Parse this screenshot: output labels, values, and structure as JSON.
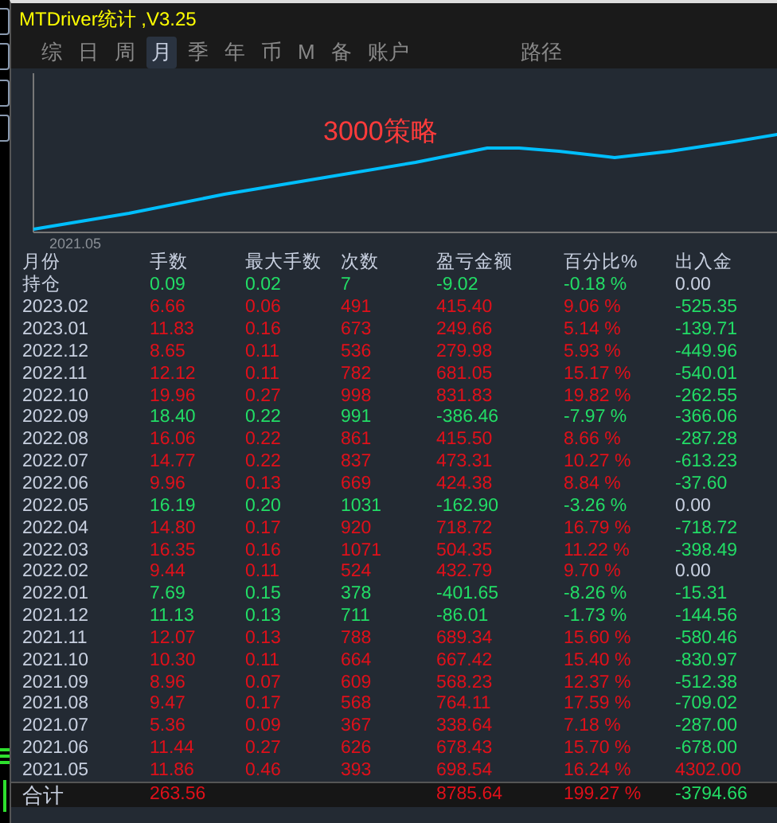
{
  "window": {
    "title": "MTDriver统计 ,V3.25"
  },
  "tabs": [
    {
      "label": "综",
      "selected": false
    },
    {
      "label": "日",
      "selected": false
    },
    {
      "label": "周",
      "selected": false
    },
    {
      "label": "月",
      "selected": true
    },
    {
      "label": "季",
      "selected": false
    },
    {
      "label": "年",
      "selected": false
    },
    {
      "label": "币",
      "selected": false
    },
    {
      "label": "M",
      "selected": false
    },
    {
      "label": "备",
      "selected": false
    },
    {
      "label": "账户",
      "selected": false
    },
    {
      "label": "路径",
      "selected": false
    }
  ],
  "chart": {
    "title": "3000策略",
    "x_label": "2021.05"
  },
  "table": {
    "columns": [
      "月份",
      "手数",
      "最大手数",
      "次数",
      "盈亏金额",
      "百分比%",
      "出入金"
    ],
    "position": {
      "month": "持仓",
      "lots": "0.09",
      "max_lots": "0.02",
      "count": "7",
      "profit": "-9.02",
      "pct": "-0.18 %",
      "color": "#22dd66",
      "flow": {
        "text": "0.00",
        "color": "#c8d0e0"
      }
    },
    "rows": [
      {
        "month": "2023.02",
        "lots": "6.66",
        "max_lots": "0.06",
        "count": "491",
        "profit": "415.40",
        "pct": "9.06 %",
        "color": "#e0101a",
        "flow": {
          "text": "-525.35",
          "color": "#22dd66"
        }
      },
      {
        "month": "2023.01",
        "lots": "11.83",
        "max_lots": "0.16",
        "count": "673",
        "profit": "249.66",
        "pct": "5.14 %",
        "color": "#e0101a",
        "flow": {
          "text": "-139.71",
          "color": "#22dd66"
        }
      },
      {
        "month": "2022.12",
        "lots": "8.65",
        "max_lots": "0.11",
        "count": "536",
        "profit": "279.98",
        "pct": "5.93 %",
        "color": "#e0101a",
        "flow": {
          "text": "-449.96",
          "color": "#22dd66"
        }
      },
      {
        "month": "2022.11",
        "lots": "12.12",
        "max_lots": "0.11",
        "count": "782",
        "profit": "681.05",
        "pct": "15.17 %",
        "color": "#e0101a",
        "flow": {
          "text": "-540.01",
          "color": "#22dd66"
        }
      },
      {
        "month": "2022.10",
        "lots": "19.96",
        "max_lots": "0.27",
        "count": "998",
        "profit": "831.83",
        "pct": "19.82 %",
        "color": "#e0101a",
        "flow": {
          "text": "-262.55",
          "color": "#22dd66"
        }
      },
      {
        "month": "2022.09",
        "lots": "18.40",
        "max_lots": "0.22",
        "count": "991",
        "profit": "-386.46",
        "pct": "-7.97 %",
        "color": "#22dd66",
        "flow": {
          "text": "-366.06",
          "color": "#22dd66"
        }
      },
      {
        "month": "2022.08",
        "lots": "16.06",
        "max_lots": "0.22",
        "count": "861",
        "profit": "415.50",
        "pct": "8.66 %",
        "color": "#e0101a",
        "flow": {
          "text": "-287.28",
          "color": "#22dd66"
        }
      },
      {
        "month": "2022.07",
        "lots": "14.77",
        "max_lots": "0.22",
        "count": "837",
        "profit": "473.31",
        "pct": "10.27 %",
        "color": "#e0101a",
        "flow": {
          "text": "-613.23",
          "color": "#22dd66"
        }
      },
      {
        "month": "2022.06",
        "lots": "9.96",
        "max_lots": "0.13",
        "count": "669",
        "profit": "424.38",
        "pct": "8.84 %",
        "color": "#e0101a",
        "flow": {
          "text": "-37.60",
          "color": "#22dd66"
        }
      },
      {
        "month": "2022.05",
        "lots": "16.19",
        "max_lots": "0.20",
        "count": "1031",
        "profit": "-162.90",
        "pct": "-3.26 %",
        "color": "#22dd66",
        "flow": {
          "text": "0.00",
          "color": "#c8d0e0"
        }
      },
      {
        "month": "2022.04",
        "lots": "14.80",
        "max_lots": "0.17",
        "count": "920",
        "profit": "718.72",
        "pct": "16.79 %",
        "color": "#e0101a",
        "flow": {
          "text": "-718.72",
          "color": "#22dd66"
        }
      },
      {
        "month": "2022.03",
        "lots": "16.35",
        "max_lots": "0.16",
        "count": "1071",
        "profit": "504.35",
        "pct": "11.22 %",
        "color": "#e0101a",
        "flow": {
          "text": "-398.49",
          "color": "#22dd66"
        }
      },
      {
        "month": "2022.02",
        "lots": "9.44",
        "max_lots": "0.11",
        "count": "524",
        "profit": "432.79",
        "pct": "9.70 %",
        "color": "#e0101a",
        "flow": {
          "text": "0.00",
          "color": "#c8d0e0"
        }
      },
      {
        "month": "2022.01",
        "lots": "7.69",
        "max_lots": "0.15",
        "count": "378",
        "profit": "-401.65",
        "pct": "-8.26 %",
        "color": "#22dd66",
        "flow": {
          "text": "-15.31",
          "color": "#22dd66"
        }
      },
      {
        "month": "2021.12",
        "lots": "11.13",
        "max_lots": "0.13",
        "count": "711",
        "profit": "-86.01",
        "pct": "-1.73 %",
        "color": "#22dd66",
        "flow": {
          "text": "-144.56",
          "color": "#22dd66"
        }
      },
      {
        "month": "2021.11",
        "lots": "12.07",
        "max_lots": "0.13",
        "count": "788",
        "profit": "689.34",
        "pct": "15.60 %",
        "color": "#e0101a",
        "flow": {
          "text": "-580.46",
          "color": "#22dd66"
        }
      },
      {
        "month": "2021.10",
        "lots": "10.30",
        "max_lots": "0.11",
        "count": "664",
        "profit": "667.42",
        "pct": "15.40 %",
        "color": "#e0101a",
        "flow": {
          "text": "-830.97",
          "color": "#22dd66"
        }
      },
      {
        "month": "2021.09",
        "lots": "8.96",
        "max_lots": "0.07",
        "count": "609",
        "profit": "568.23",
        "pct": "12.37 %",
        "color": "#e0101a",
        "flow": {
          "text": "-512.38",
          "color": "#22dd66"
        }
      },
      {
        "month": "2021.08",
        "lots": "9.47",
        "max_lots": "0.17",
        "count": "568",
        "profit": "764.11",
        "pct": "17.59 %",
        "color": "#e0101a",
        "flow": {
          "text": "-709.02",
          "color": "#22dd66"
        }
      },
      {
        "month": "2021.07",
        "lots": "5.36",
        "max_lots": "0.09",
        "count": "367",
        "profit": "338.64",
        "pct": "7.18 %",
        "color": "#e0101a",
        "flow": {
          "text": "-287.00",
          "color": "#22dd66"
        }
      },
      {
        "month": "2021.06",
        "lots": "11.44",
        "max_lots": "0.27",
        "count": "626",
        "profit": "678.43",
        "pct": "15.70 %",
        "color": "#e0101a",
        "flow": {
          "text": "-678.00",
          "color": "#22dd66"
        }
      },
      {
        "month": "2021.05",
        "lots": "11.86",
        "max_lots": "0.46",
        "count": "393",
        "profit": "698.54",
        "pct": "16.24 %",
        "color": "#e0101a",
        "flow": {
          "text": "4302.00",
          "color": "#e0101a"
        }
      }
    ],
    "total": {
      "label": "合计",
      "lots": "263.56",
      "profit": "8785.64",
      "pct": "199.27 %",
      "flow": "-3794.66"
    }
  }
}
